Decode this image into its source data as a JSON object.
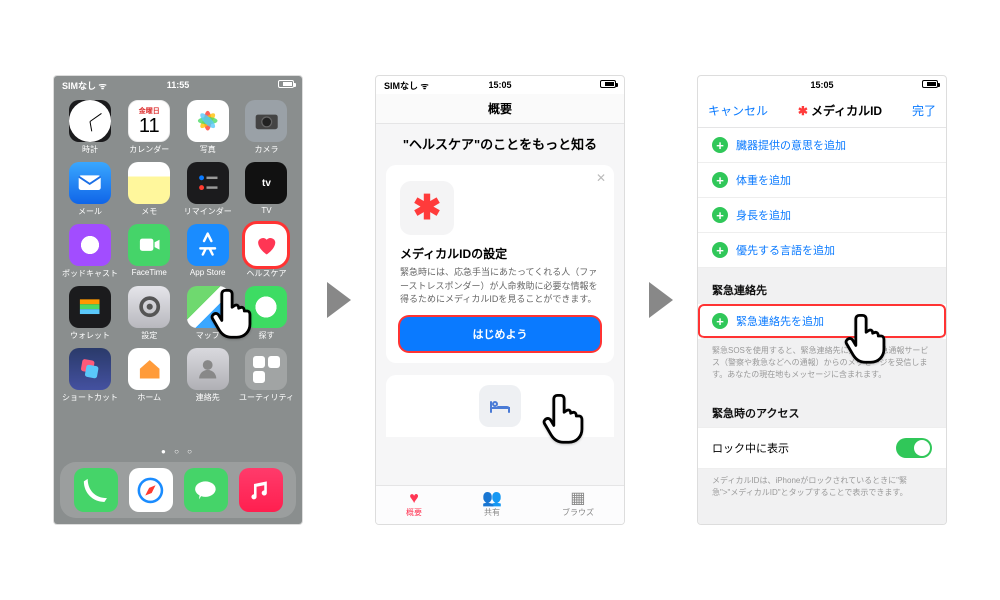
{
  "status": {
    "carrier": "SIMなし",
    "wifi": "✓",
    "time1": "11:55",
    "time2": "15:05",
    "time3": "15:05"
  },
  "phone1": {
    "apps": [
      {
        "label": "時計"
      },
      {
        "label": "カレンダー",
        "day": "金曜日",
        "num": "11"
      },
      {
        "label": "写真"
      },
      {
        "label": "カメラ"
      },
      {
        "label": "メール"
      },
      {
        "label": "メモ"
      },
      {
        "label": "リマインダー"
      },
      {
        "label": "TV"
      },
      {
        "label": "ポッドキャスト"
      },
      {
        "label": "FaceTime"
      },
      {
        "label": "App Store"
      },
      {
        "label": "ヘルスケア"
      },
      {
        "label": "ウォレット"
      },
      {
        "label": "設定"
      },
      {
        "label": "マップ"
      },
      {
        "label": "探す"
      },
      {
        "label": "ショートカット"
      },
      {
        "label": "ホーム"
      },
      {
        "label": "連絡先"
      },
      {
        "label": "ユーティリティ"
      }
    ],
    "dock": [
      {
        "label": "電話"
      },
      {
        "label": "Safari"
      },
      {
        "label": "メッセージ"
      },
      {
        "label": "ミュージック"
      }
    ]
  },
  "phone2": {
    "title": "概要",
    "hero": "\"ヘルスケア\"のことをもっと知る",
    "card": {
      "heading": "メディカルIDの設定",
      "body": "緊急時には、応急手当にあたってくれる人（ファーストレスポンダー）が人命救助に必要な情報を得るためにメディカルIDを見ることができます。",
      "cta": "はじめよう"
    },
    "tabs": [
      {
        "label": "概要"
      },
      {
        "label": "共有"
      },
      {
        "label": "ブラウズ"
      }
    ]
  },
  "phone3": {
    "nav": {
      "cancel": "キャンセル",
      "title": "メディカルID",
      "done": "完了"
    },
    "rows": [
      "臓器提供の意思を追加",
      "体重を追加",
      "身長を追加",
      "優先する言語を追加"
    ],
    "section": "緊急連絡先",
    "emerg_row": "緊急連絡先を追加",
    "emerg_help": "緊急SOSを使用すると、緊急連絡先に対して緊急通報サービス（警察や救急などへの通報）からのメッセージを受信します。あなたの現在地もメッセージに含まれます。",
    "access_h": "緊急時のアクセス",
    "lock_row": "ロック中に表示",
    "lock_help": "メディカルIDは、iPhoneがロックされているときに\"緊急\">\"メディカルID\"とタップすることで表示できます。"
  }
}
